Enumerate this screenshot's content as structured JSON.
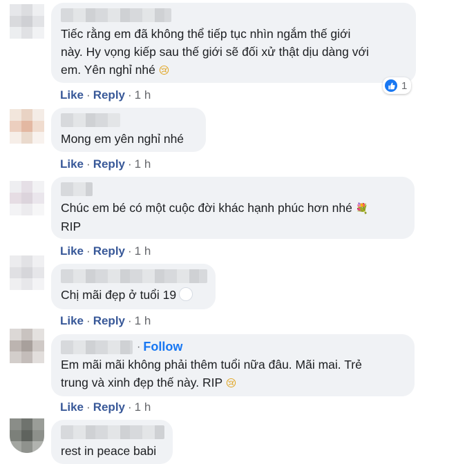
{
  "comments": [
    {
      "text_lines": [
        "Tiếc rằng em đã không thể tiếp tục nhìn ngắm thế giới",
        "này. Hy vọng kiếp sau thế giới sẽ đối xử thật dịu dàng với",
        "em. Yên nghỉ nhé"
      ],
      "emoji": "crying-face",
      "reaction_count": "1",
      "actions": {
        "like": "Like",
        "reply": "Reply",
        "time": "1 h"
      }
    },
    {
      "text_lines": [
        "Mong em yên nghỉ nhé"
      ],
      "actions": {
        "like": "Like",
        "reply": "Reply",
        "time": "1 h"
      }
    },
    {
      "text_lines": [
        "Chúc em bé có một cuộc đời khác hạnh phúc hơn nhé",
        "RIP"
      ],
      "emoji": "bouquet",
      "actions": {
        "like": "Like",
        "reply": "Reply",
        "time": "1 h"
      }
    },
    {
      "text_lines": [
        "Chị mãi đẹp ở tuổi 19"
      ],
      "emoji": "white-heart",
      "actions": {
        "like": "Like",
        "reply": "Reply",
        "time": "1 h"
      }
    },
    {
      "follow_label": "Follow",
      "text_lines": [
        "Em mãi mãi không phải thêm tuổi nữa đâu. Mãi mai. Trẻ",
        "trung và xinh đẹp thế này. RIP"
      ],
      "emoji": "crying-face",
      "actions": {
        "like": "Like",
        "reply": "Reply",
        "time": "1 h"
      }
    },
    {
      "text_lines": [
        "rest in peace babi"
      ]
    }
  ],
  "separator": "·",
  "colors": {
    "bubble": "#f0f2f5",
    "link": "#385898",
    "meta": "#65676b",
    "follow": "#1877f2",
    "like_badge": "#1877f2"
  }
}
